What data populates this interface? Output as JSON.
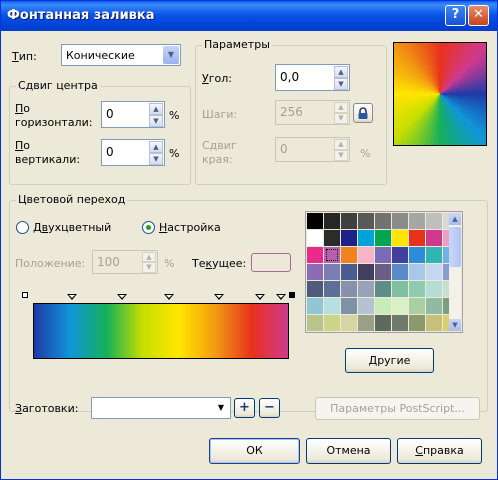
{
  "window": {
    "title": "Фонтанная заливка",
    "help_button": "?",
    "close_button": "✕"
  },
  "type": {
    "label_underlined": "Т",
    "label_rest": "ип:",
    "value": "Конические"
  },
  "center_offset": {
    "group_title": "Сдвиг центра",
    "horizontal_label_underlined": "П",
    "horizontal_label_rest": "о",
    "horizontal_label_line2": "горизонтали:",
    "horizontal_value": "0",
    "vertical_label_underlined": "П",
    "vertical_label_rest": "о",
    "vertical_label_line2": "вертикали:",
    "vertical_value": "0",
    "percent": "%"
  },
  "params": {
    "group_title": "Параметры",
    "angle_label_underlined": "У",
    "angle_label_rest": "гол:",
    "angle_value": "0,0",
    "steps_label": "Шаги:",
    "steps_value": "256",
    "edge_label_line1": "Сдвиг",
    "edge_label_line2": "края:",
    "edge_value": "0",
    "percent": "%"
  },
  "blend": {
    "group_title": "Цветовой переход",
    "two_color_label_pre": "Д",
    "two_color_label_underlined": "в",
    "two_color_label_rest": "ухцветный",
    "custom_label_underlined": "Н",
    "custom_label_rest": "астройка",
    "position_label": "Положение:",
    "position_value": "100",
    "percent": "%",
    "current_label_pre": "Те",
    "current_label_underlined": "к",
    "current_label_rest": "ущее:",
    "other_button": "Другие",
    "gradient_colors": [
      "#1f3aa8",
      "#1095d8",
      "#16b05a",
      "#c7de00",
      "#ffe600",
      "#f29a12",
      "#e8321c",
      "#cf3a8e"
    ],
    "palette": [
      "#000000",
      "#262626",
      "#3f3f3f",
      "#595959",
      "#727272",
      "#8c8c8c",
      "#a6a6a6",
      "#bfbfbf",
      "#d9d9d9",
      "#ffffff",
      "#2b2b2b",
      "#1f1f8a",
      "#00a3d9",
      "#00a651",
      "#ffe600",
      "#e8321c",
      "#cf3a8e",
      "#e8a0c8",
      "#e82a8a",
      "#b85db0",
      "#f2821f",
      "#f6b5c6",
      "#7a6bb8",
      "#43409a",
      "#2c8cd9",
      "#31b4b3",
      "#6eb3e4",
      "#8c6ab4",
      "#7c7fb4",
      "#4a5c8e",
      "#42405e",
      "#6a5e88",
      "#5a8ccc",
      "#a9c7e8",
      "#c4d8ef",
      "#8a9bd0",
      "#4d5a7b",
      "#5d6e99",
      "#8591ad",
      "#9aa2b8",
      "#5e8d89",
      "#7fbe9f",
      "#8fcbb0",
      "#b6ddd4",
      "#c5dfd1",
      "#92c6d7",
      "#b6dfe0",
      "#7d93a5",
      "#b5c2d0",
      "#c6ecb9",
      "#d9f0c6",
      "#a9cfa2",
      "#8fbca1",
      "#7a9f82",
      "#b7c58a",
      "#cbd58a",
      "#d4d4a4",
      "#9aa088",
      "#5f6a5f",
      "#6e7a6a",
      "#8a9a6a",
      "#c6c07a",
      "#d8cf6e"
    ]
  },
  "presets": {
    "label_underlined": "З",
    "label_rest": "аготовки:",
    "value": "",
    "add_button": "+",
    "remove_button": "−",
    "postscript_button": "Параметры PostScript..."
  },
  "buttons": {
    "ok": "ОК",
    "cancel": "Отмена",
    "help_underlined": "С",
    "help_rest": "правка"
  }
}
